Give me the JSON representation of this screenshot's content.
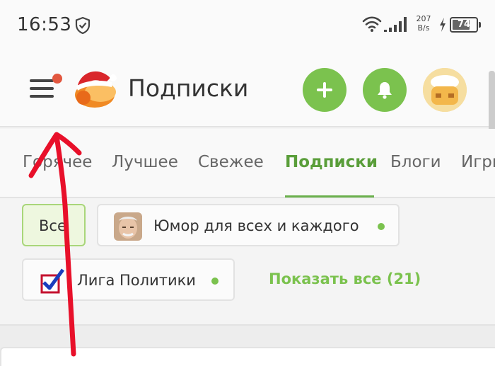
{
  "status_bar": {
    "time": "16:53",
    "net_speed_value": "207",
    "net_speed_unit": "B/s",
    "battery_level": "74",
    "battery_fraction": 0.74
  },
  "app_bar": {
    "title": "Подписки",
    "has_notification": true,
    "accent_color": "#7bc24e",
    "notification_color": "#e2573f"
  },
  "tabs": [
    {
      "label": "Горячее",
      "active": false
    },
    {
      "label": "Лучшее",
      "active": false
    },
    {
      "label": "Свежее",
      "active": false
    },
    {
      "label": "Подписки",
      "active": true
    },
    {
      "label": "Блоги",
      "active": false
    },
    {
      "label": "Игры",
      "active": false
    }
  ],
  "subscriptions": {
    "all_label": "Все",
    "items": [
      {
        "label": "Юмор для всех и каждого",
        "icon": "humor-avatar-icon",
        "has_new": true
      },
      {
        "label": "Лига Политики",
        "icon": "checkbox-vote-icon",
        "has_new": true
      }
    ],
    "show_all_label": "Показать все (21)"
  },
  "annotation": {
    "type": "hand-drawn-arrow",
    "color": "#e8102a",
    "points_to": "menu-button"
  }
}
